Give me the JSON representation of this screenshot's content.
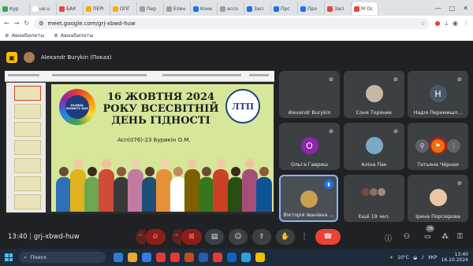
{
  "browser": {
    "tabs": [
      {
        "label": "Кур",
        "color": "#34a853"
      },
      {
        "label": "uo.u",
        "color": "#ffffff"
      },
      {
        "label": "БАК",
        "color": "#ea4335"
      },
      {
        "label": "ПЕРІ",
        "color": "#f9ab00"
      },
      {
        "label": "ОПГ",
        "color": "#f9ab00"
      },
      {
        "label": "Пер",
        "color": "#9aa0a6"
      },
      {
        "label": "Елен",
        "color": "#9aa0a6"
      },
      {
        "label": "Конк",
        "color": "#1a73e8"
      },
      {
        "label": "ассо",
        "color": "#9aa0a6"
      },
      {
        "label": "Засі",
        "color": "#1a73e8"
      },
      {
        "label": "Прс",
        "color": "#1a73e8"
      },
      {
        "label": "Про",
        "color": "#1a73e8"
      },
      {
        "label": "Засі",
        "color": "#ea4335"
      },
      {
        "label": "M Ос",
        "color": "#ea4335"
      }
    ],
    "active_tab": "M Ос",
    "url": "meet.google.com/grj-xbwd-huw",
    "bookmarks": [
      "Авиабилеты",
      "Авиабилеты"
    ]
  },
  "meet": {
    "presenter_label": "Alexandr Burykin (Показ)",
    "time": "13:40",
    "meeting_code": "grj-xbwd-huw",
    "participant_count": "28",
    "tiles": [
      {
        "name": "Alexandr Burykin",
        "initial": "",
        "avatar_color": "#3c4043",
        "muted": true
      },
      {
        "name": "Соня Торяник",
        "initial": "",
        "avatar_color": "#c9b6a3",
        "muted": true
      },
      {
        "name": "Надія Перемишл...",
        "initial": "Н",
        "avatar_color": "#455a64",
        "muted": true
      },
      {
        "name": "Ольга Гавриш",
        "initial": "О",
        "avatar_color": "#8e24aa",
        "muted": true
      },
      {
        "name": "Аліна Пак",
        "initial": "",
        "avatar_color": "#7ba9c7",
        "muted": true
      },
      {
        "name": "Татьяна Чёрная",
        "initial": "",
        "avatar_color": "#b71c1c",
        "muted": false
      },
      {
        "name": "Вікторія Іванівна ...",
        "initial": "",
        "avatar_color": "#c8a050",
        "muted": false
      },
      {
        "name": "Ещё 19 чел.",
        "initial": "",
        "avatar_color": "#3c4043",
        "muted": false
      },
      {
        "name": "Ірина Порсюрова",
        "initial": "",
        "avatar_color": "#e8c8a8",
        "muted": true
      }
    ]
  },
  "slide": {
    "title_line1": "16 ЖОВТНЯ 2024",
    "title_line2": "РОКУ ВСЕСВІТНІЙ",
    "title_line3": "ДЕНЬ ГІДНОСТІ",
    "subtitle": "Асп(076)-23 Бурикін О.М.",
    "logo_left": "GLOBAL DIGNITY DAY",
    "logo_right": "ЛТП"
  },
  "taskbar": {
    "search_placeholder": "Поиск",
    "temperature": "10°C",
    "language": "УКР",
    "time": "13:40",
    "date": "16.10.2024"
  }
}
